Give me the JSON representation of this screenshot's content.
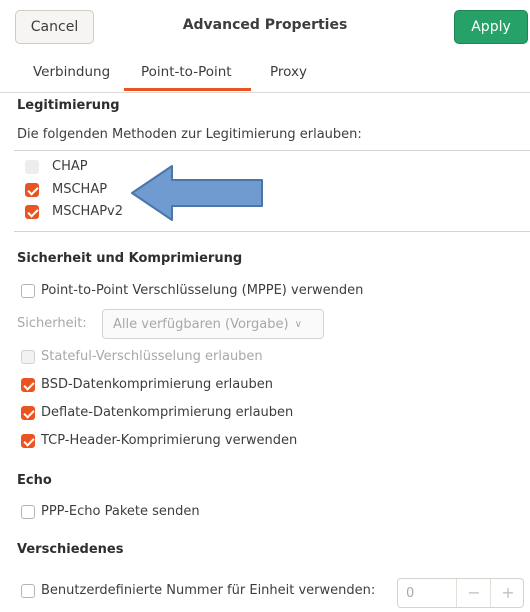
{
  "header": {
    "cancel_label": "Cancel",
    "title": "Advanced Properties",
    "apply_label": "Apply"
  },
  "tabs": [
    {
      "label": "Verbindung",
      "active": false
    },
    {
      "label": "Point-to-Point",
      "active": true
    },
    {
      "label": "Proxy",
      "active": false
    }
  ],
  "auth": {
    "heading": "Legitimierung",
    "description": "Die folgenden Methoden zur Legitimierung erlauben:",
    "methods": [
      {
        "label": "CHAP",
        "checked": false
      },
      {
        "label": "MSCHAP",
        "checked": true
      },
      {
        "label": "MSCHAPv2",
        "checked": true
      }
    ]
  },
  "security": {
    "heading": "Sicherheit und Komprimierung",
    "mppe_label": "Point-to-Point Verschlüsselung (MPPE) verwenden",
    "mppe_checked": false,
    "sicherheit_label": "Sicherheit:",
    "sicherheit_value": "Alle verfügbaren (Vorgabe)",
    "stateful_label": "Stateful-Verschlüsselung erlauben",
    "stateful_checked": false,
    "bsd_label": "BSD-Datenkomprimierung erlauben",
    "bsd_checked": true,
    "deflate_label": "Deflate-Datenkomprimierung erlauben",
    "deflate_checked": true,
    "tcp_label": "TCP-Header-Komprimierung verwenden",
    "tcp_checked": true
  },
  "echo": {
    "heading": "Echo",
    "ppp_label": "PPP-Echo Pakete senden",
    "ppp_checked": false
  },
  "misc": {
    "heading": "Verschiedenes",
    "unit_label": "Benutzerdefinierte Nummer für Einheit verwenden:",
    "unit_checked": false,
    "unit_value": "0",
    "minus": "−",
    "plus": "+"
  },
  "colors": {
    "accent": "#e95420",
    "apply": "#26a269",
    "arrow_fill": "#6f9bd0",
    "arrow_stroke": "#4a76a8"
  },
  "icons": {
    "chevron": "chevron-down-icon",
    "arrow": "arrow-left-icon"
  }
}
